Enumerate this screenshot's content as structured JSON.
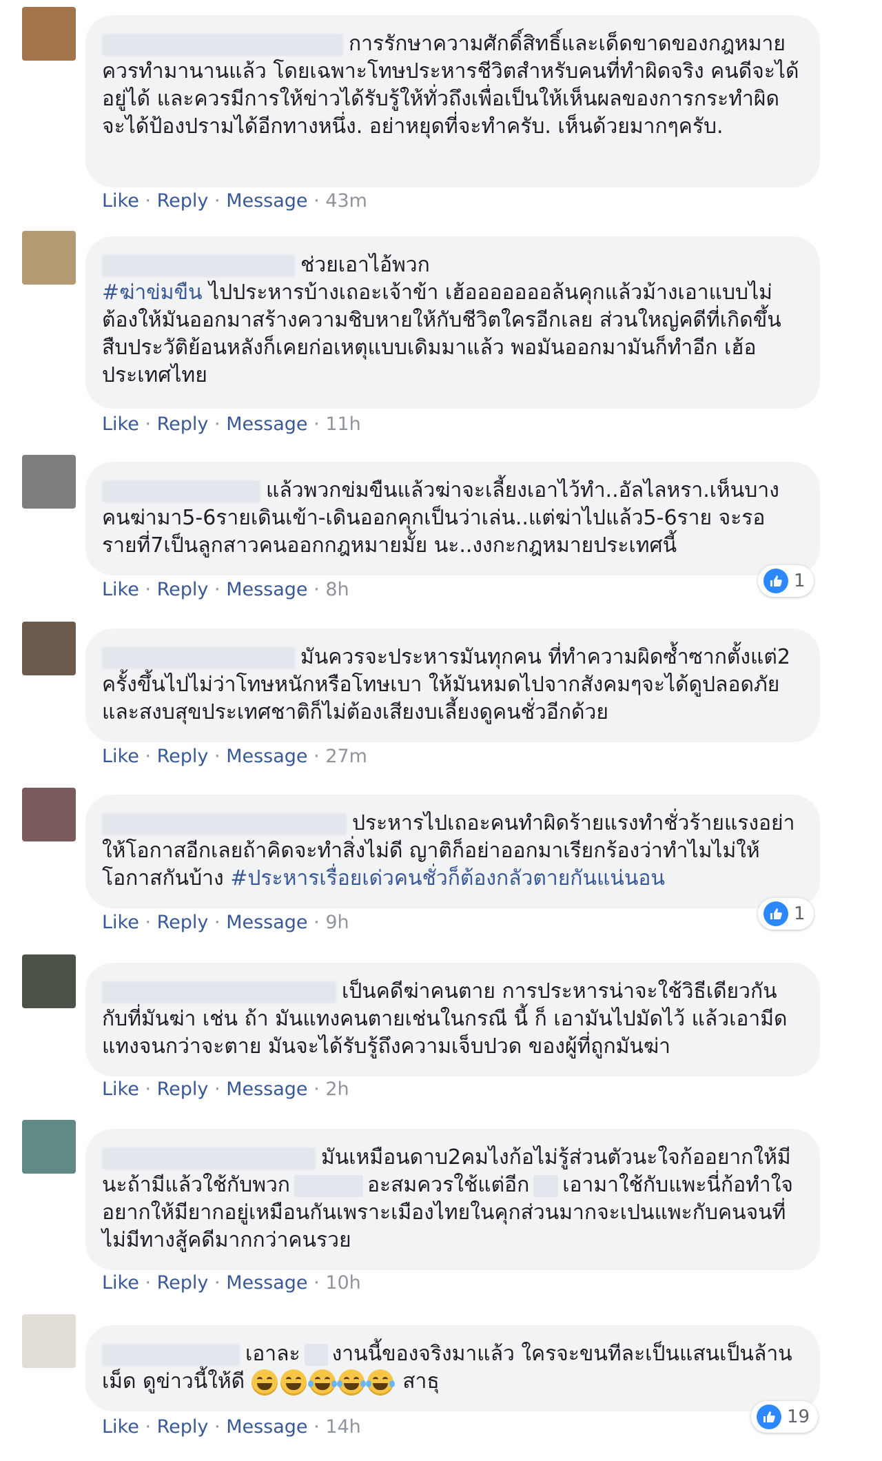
{
  "actions": {
    "like": "Like",
    "reply": "Reply",
    "message": "Message",
    "separator": "·"
  },
  "comments": [
    {
      "avatar_color": "#a4744a",
      "text": "การรักษาความศักดิ์สิทธิ์และเด็ดขาดของกฎหมายควรทำมานานแล้ว โดยเฉพาะโทษประหารชีวิตสำหรับคนที่ทำผิดจริง คนดีจะได้อยู่ได้ และควรมีการให้ข่าวได้รับรู้ให้ทั่วถึงเพื่อเป็นให้เห็นผลของการกระทำผิดจะได้ป้องปรามได้อีกทางหนึ่ง. อย่าหยุดที่จะทำครับ. เห็นด้วยมากๆครับ.",
      "time": "43m"
    },
    {
      "avatar_color": "#b39a73",
      "text_before": "ช่วยเอาไอ้พวก",
      "hashtag": "#ฆ่าข่มขืน",
      "text": "ไปประหารบ้างเถอะเจ้าข้า เฮ้อออออออล้นคุกแล้วม้างเอาแบบไม่ต้องให้มันออกมาสร้างความชิบหายให้กับชีวิตใครอีกเลย ส่วนใหญ่คดีที่เกิดขึ้น สืบประวัติย้อนหลังก็เคยก่อเหตุแบบเดิมมาแล้ว พอมันออกมามันก็ทำอีก เฮ้อ ประเทศไทย",
      "time": "11h"
    },
    {
      "avatar_color": "#7d7e80",
      "text": "แล้วพวกข่มขืนแล้วฆ่าจะเลี้ยงเอาไว้ทำ..อัลไลหรา.เห็นบางคนฆ่ามา5-6รายเดินเข้า-เดินออกคุกเป็นว่าเล่น..แต่ฆ่าไปแล้ว5-6ราย จะรอรายที่7เป็นลูกสาวคนออกกฎหมายมั้ย นะ..งงกะกฎหมายประเทศนี้",
      "time": "8h",
      "likes": "1"
    },
    {
      "avatar_color": "#6c5a4c",
      "text": "มันควรจะประหารมันทุกคน ที่ทำความผิดซ้ำซากตั้งแต่2 ครั้งขึ้นไปไม่ว่าโทษหนักหรือโทษเบา ให้มันหมดไปจากสังคมๆจะได้ดูปลอดภัยและสงบสุขประเทศชาติก็ไม่ต้องเสียงบเลี้ยงดูคนชั่วอีกด้วย",
      "time": "27m"
    },
    {
      "avatar_color": "#7a5a5c",
      "text": "ประหารไปเถอะคนทำผิดร้ายแรงทำชั่วร้ายแรงอย่าให้โอกาสอีกเลยถ้าคิดจะทำสิ่งไม่ดี ญาติก็อย่าออกมาเรียกร้องว่าทำไมไม่ให้โอกาสกันบ้าง",
      "hashtag": "#ประหารเรื่อยเด่วคนชั่วก็ต้องกลัวตายกันแน่นอน",
      "time": "9h",
      "likes": "1"
    },
    {
      "avatar_color": "#4d5248",
      "text": "เป็นคดีฆ่าคนตาย การประหารน่าจะใช้วิธีเดียวกันกับที่มันฆ่า เช่น ถ้า มันแทงคนตายเช่นในกรณี นี้ ก็ เอามันไปมัดไว้ แล้วเอามีดแทงจนกว่าจะตาย มันจะได้รับรู้ถึงความเจ็บปวด ของผู้ที่ถูกมันฆ่า",
      "time": "2h"
    },
    {
      "avatar_color": "#5f8a86",
      "text_a": "มันเหมือนดาบ2คมไงก้อไม่รู้ส่วนตัวนะใจก้ออยากให้มีนะถ้ามีแล้วใช้กับพวก",
      "text_b": "อะสมควรใช้แต่อีก",
      "text_c": "เอามาใช้กับแพะนี่ก้อทำใจอยากให้มียากอยู่เหมือนกันเพราะเมืองไทยในคุกส่วนมากจะเปนแพะกับคนจนที่ไม่มีทางสู้คดีมากกว่าคนรวย",
      "time": "10h"
    },
    {
      "avatar_color": "#e2ddd6",
      "text_a": "เอาละ",
      "text_b": "งานนี้ของจริงมาแล้ว ใครจะขนทีละเป็นแสนเป็นล้านเม็ด ดูข่าวนี้ให้ดี",
      "text_c": "สาธุ",
      "emojis": [
        "grin-icon",
        "grin-icon",
        "joy-icon",
        "joy-icon",
        "joy-icon"
      ],
      "time": "14h",
      "likes": "19"
    }
  ]
}
